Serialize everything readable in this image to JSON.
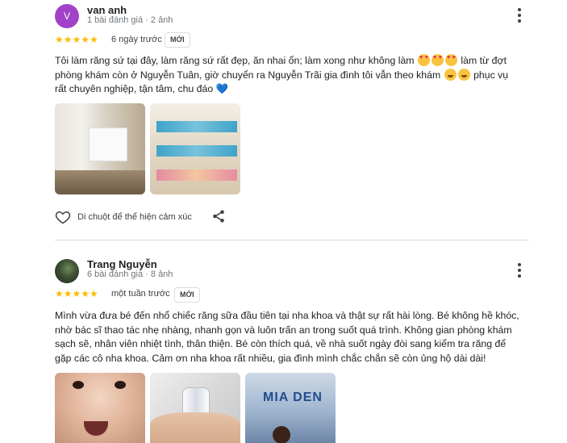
{
  "reviews": [
    {
      "avatar_letter": "V",
      "name": "van anh",
      "meta": "1 bài đánh giá · 2 ảnh",
      "stars": "★★★★★",
      "rating": 5,
      "when": "6 ngày trước",
      "badge": "MỚI",
      "text_1": "Tôi làm răng sứ tại đây, làm răng sứ rất đẹp, ăn nhai ổn; làm xong như không làm ",
      "text_2": " làm từ đợt",
      "text_3": "phòng khám còn ở Nguyễn Tuân, giờ chuyển ra Nguyễn Trãi gia đình tôi vẫn theo khám ",
      "text_4": " phục vụ",
      "text_5": "rất chuyên nghiệp, tận tâm, chu đáo ",
      "blue_heart": "💙",
      "react_label": "Di chuột để thể hiện cảm xúc"
    },
    {
      "name": "Trang Nguyễn",
      "meta": "6 bài đánh giá · 8 ảnh",
      "stars": "★★★★★",
      "rating": 5,
      "when": "một tuần trước",
      "badge": "MỚI",
      "text_lines": [
        "Mình vừa đưa bé đến nhổ chiếc răng sữa đầu tiên tại nha khoa và thật sự rất hài lòng. Bé không hề khóc,",
        "nhờ bác sĩ thao tác nhẹ nhàng, nhanh gọn và luôn trấn an trong suốt quá trình. Không gian phòng khám",
        "sạch sẽ, nhân viên nhiệt tình, thân thiện. Bé còn thích quá, về nhà suốt ngày đòi sang kiểm tra răng để",
        "gặp các cô nha khoa. Cảm ơn nha khoa rất nhiều, gia đình mình chắc chắn sẽ còn ủng hộ dài dài!"
      ],
      "photo_sign": "MIA DEN"
    }
  ],
  "colors": {
    "star": "#fbbc04",
    "avatar_v": "#a142c9",
    "divider": "#dadce0"
  },
  "icons": [
    "more-vert-icon",
    "heart-outline-icon",
    "share-icon"
  ]
}
